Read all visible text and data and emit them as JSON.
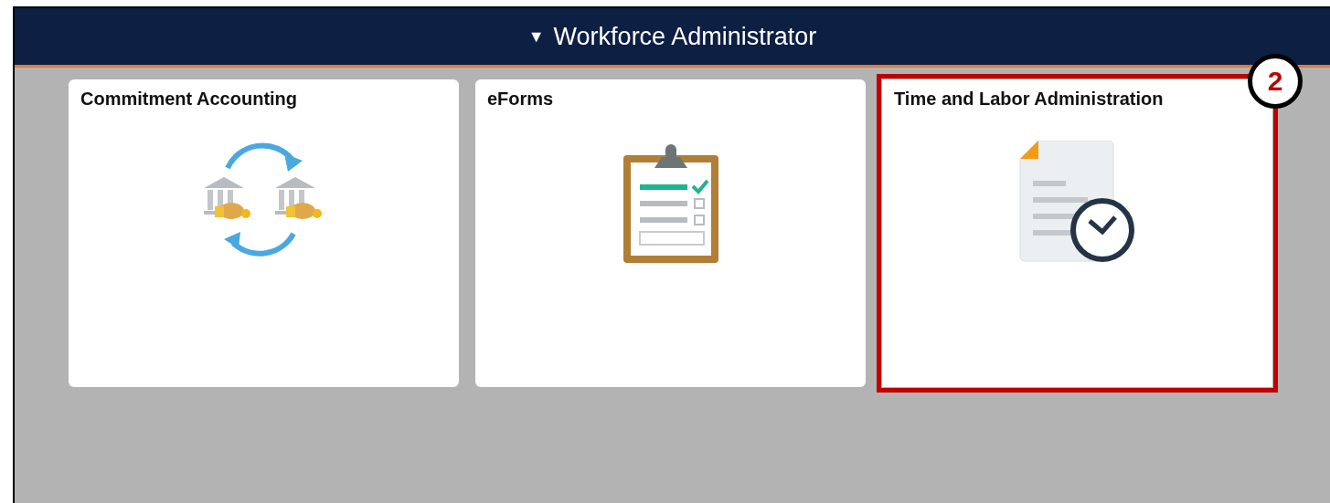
{
  "header": {
    "toggle": "▼",
    "title": "Workforce Administrator"
  },
  "tiles": [
    {
      "title": "Commitment Accounting",
      "kind": "banks",
      "highlighted": false
    },
    {
      "title": "eForms",
      "kind": "clipboard",
      "highlighted": false
    },
    {
      "title": "Time and Labor Administration",
      "kind": "timesheet",
      "highlighted": true,
      "callout": "2"
    }
  ]
}
